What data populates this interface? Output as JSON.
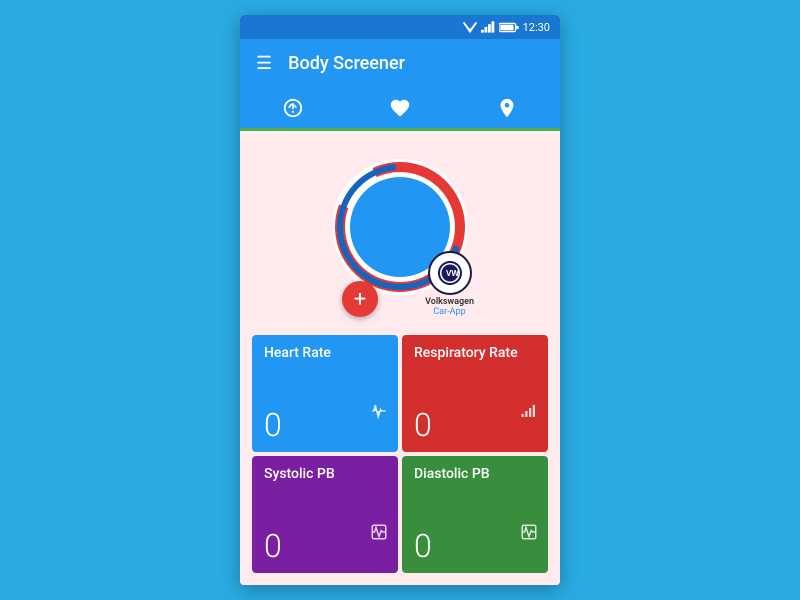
{
  "statusBar": {
    "time": "12:30",
    "wifiIcon": "wifi",
    "signalIcon": "signal",
    "batteryIcon": "battery"
  },
  "topBar": {
    "menuIcon": "☰",
    "title": "Body Screener"
  },
  "tabs": [
    {
      "id": "speed",
      "label": "Speed",
      "active": false
    },
    {
      "id": "heart",
      "label": "Heart",
      "active": true
    },
    {
      "id": "location",
      "label": "Location",
      "active": false
    }
  ],
  "gauge": {
    "redArcDegrees": 270,
    "blueRingColor": "#1565C0",
    "innerColor": "#2196F3"
  },
  "fab": {
    "label": "+"
  },
  "vwLogo": {
    "name": "Volkswagen",
    "subtext": "Car-App"
  },
  "tiles": [
    {
      "id": "heart-rate",
      "label": "Heart Rate",
      "value": "0",
      "icon": "ecg",
      "colorClass": "tile-heart"
    },
    {
      "id": "respiratory-rate",
      "label": "Respiratory Rate",
      "value": "0",
      "icon": "chart",
      "colorClass": "tile-resp"
    },
    {
      "id": "systolic-pb",
      "label": "Systolic PB",
      "value": "0",
      "icon": "ecg",
      "colorClass": "tile-systolic"
    },
    {
      "id": "diastolic-pb",
      "label": "Diastolic PB",
      "value": "0",
      "icon": "ecg",
      "colorClass": "tile-diastolic"
    }
  ]
}
